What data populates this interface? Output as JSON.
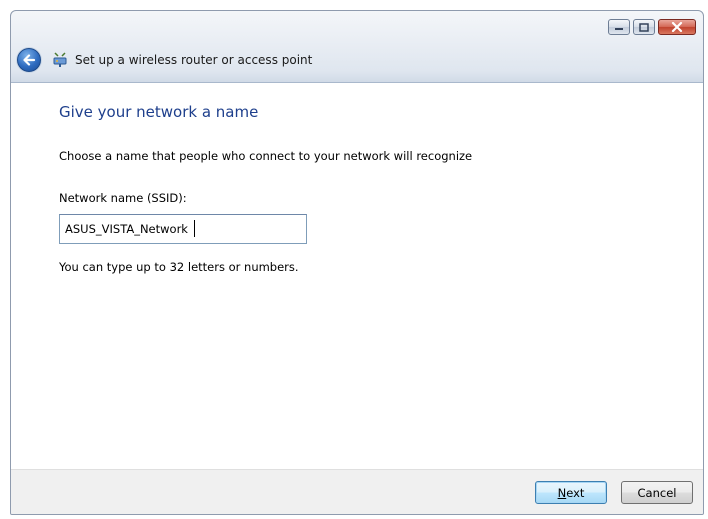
{
  "window": {
    "title": "Set up a wireless router or access point",
    "controls": [
      "minimize",
      "maximize",
      "close"
    ]
  },
  "icons": {
    "back": "back-arrow-icon",
    "router": "wireless-router-icon"
  },
  "page": {
    "heading": "Give your network a name",
    "instruction": "Choose a name that people who connect to your network will recognize",
    "ssid_label": "Network name (SSID):",
    "ssid_value": "ASUS_VISTA_Network",
    "hint": "You can type up to 32 letters or numbers."
  },
  "buttons": {
    "next_first": "N",
    "next_rest": "ext",
    "cancel": "Cancel"
  },
  "colors": {
    "heading": "#1e3f8c",
    "close_button": "#c0432e",
    "next_button": "#bee6fd"
  }
}
